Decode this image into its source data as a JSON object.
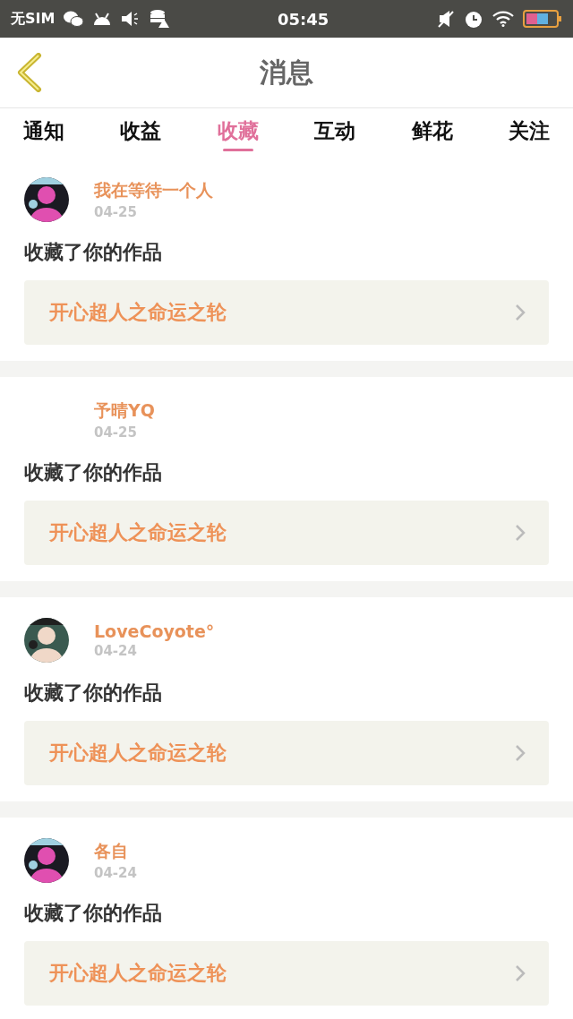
{
  "status_bar": {
    "carrier": "无SIM",
    "time": "05:45"
  },
  "header": {
    "title": "消息"
  },
  "tabs": [
    {
      "label": "通知",
      "selected": false
    },
    {
      "label": "收益",
      "selected": false
    },
    {
      "label": "收藏",
      "selected": true
    },
    {
      "label": "互动",
      "selected": false
    },
    {
      "label": "鲜花",
      "selected": false
    },
    {
      "label": "关注",
      "selected": false
    }
  ],
  "messages": [
    {
      "avatar": true,
      "name": "我在等待一个人",
      "date": "04-25",
      "action": "收藏了你的作品",
      "work": "开心超人之命运之轮"
    },
    {
      "avatar": false,
      "name": "予晴YQ",
      "date": "04-25",
      "action": "收藏了你的作品",
      "work": "开心超人之命运之轮"
    },
    {
      "avatar": true,
      "name": "LoveCoyote°",
      "date": "04-24",
      "action": "收藏了你的作品",
      "work": "开心超人之命运之轮"
    },
    {
      "avatar": true,
      "name": "各自",
      "date": "04-24",
      "action": "收藏了你的作品",
      "work": "开心超人之命运之轮"
    }
  ]
}
